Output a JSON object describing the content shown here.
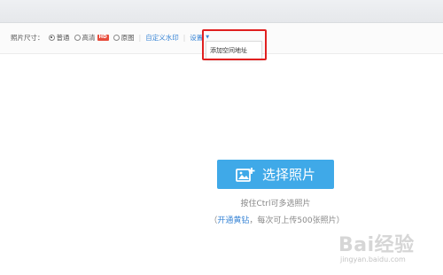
{
  "options": {
    "size_label": "照片尺寸：",
    "size_normal": "普通",
    "size_hd": "高清",
    "hd_badge": "HD",
    "size_original": "原图",
    "custom_watermark": "自定义水印",
    "settings": "设置"
  },
  "dropdown": {
    "add_space_address": "添加空间地址"
  },
  "upload": {
    "button_label": "选择照片",
    "hint_multi": "按住Ctrl可多选照片",
    "paren_open": "（",
    "vip_link": "开通黄钻",
    "vip_suffix": "，每次可上传500张照片）"
  },
  "watermark": {
    "brand": "Bai经验",
    "url": "jingyan.baidu.com"
  },
  "colors": {
    "accent": "#3a86d6",
    "button": "#3fa9e8",
    "highlight_border": "#e02020",
    "hd_badge": "#e74c3c"
  }
}
